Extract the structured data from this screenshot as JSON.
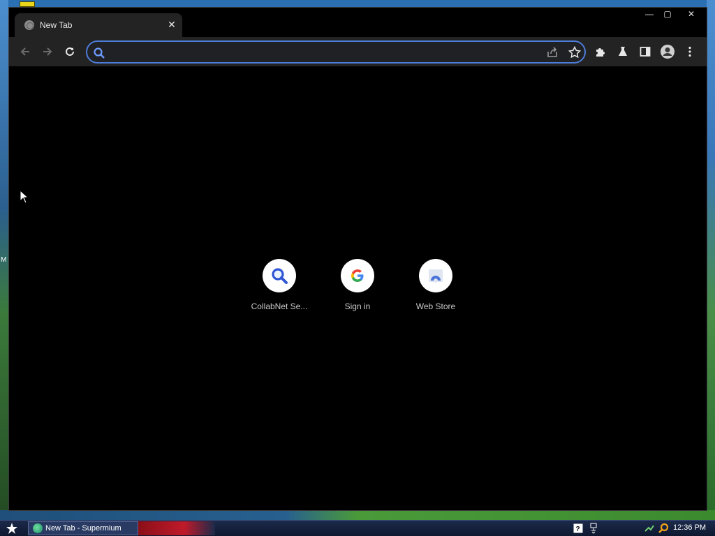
{
  "desktop": {
    "edge_letter": "M"
  },
  "window": {
    "tab": {
      "title": "New Tab",
      "close_glyph": "✕"
    },
    "controls": {
      "minimize": "—",
      "maximize": "▢",
      "close": "✕"
    }
  },
  "toolbar": {
    "back_icon": "arrow-left-icon",
    "forward_icon": "arrow-right-icon",
    "reload_icon": "reload-icon",
    "omnibox": {
      "value": "",
      "placeholder": ""
    },
    "extensions_icon": "puzzle-icon",
    "labs_icon": "flask-icon",
    "sidepanel_icon": "side-panel-icon",
    "profile_icon": "profile-icon",
    "menu_icon": "kebab-menu-icon"
  },
  "shortcuts": [
    {
      "label": "CollabNet Se...",
      "icon": "magnifier-icon"
    },
    {
      "label": "Sign in",
      "icon": "google-g-icon"
    },
    {
      "label": "Web Store",
      "icon": "web-store-icon"
    }
  ],
  "taskbar": {
    "task_label": "New Tab - Supermium",
    "clock": "12:36 PM"
  },
  "colors": {
    "accent": "#4d7dd9",
    "toolbar": "#232323",
    "page_bg": "#000000"
  }
}
